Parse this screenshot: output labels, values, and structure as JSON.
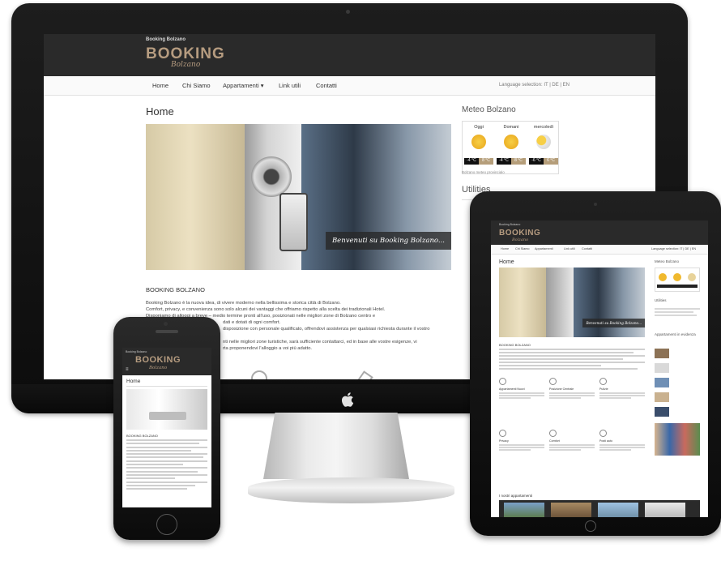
{
  "site": {
    "small_title": "Booking Bolzano",
    "brand": "BOOKING",
    "brand_sub": "Bolzano",
    "nav": [
      "Home",
      "Chi Siamo",
      "Appartamenti  ▾",
      "Link utili",
      "Contatti"
    ],
    "language": "Language selection: IT | DE | EN",
    "page_title": "Home",
    "hero_caption": "Benvenuti su Booking Bolzano...",
    "section_title": "BOOKING BOLZANO",
    "paragraphs": [
      "Booking Bolzano è la nuova idea, di vivere moderno nella bellissima e storica città di Bolzano.",
      "Comfort, privacy, e convenienza sono solo alcuni dei vantaggi che offriamo rispetto alla scelta dei tradizionali Hotel.",
      "Disponiamo di alloggi a breve – medio termine pronti all'uso, posizionati nelle migliori zone di Bolzano centro e",
      "dati e dotati di ogni comfort.",
      "disposizione con personale qualificato, offrendovi assistenza per qualsiasi richiesta durante il vostro",
      "",
      "nti nelle migliori zone turistiche, sarà sufficiente contattarci, ed in base alle vostre esigenze, vi",
      "rta proponendovi l'alloggio a voi più adatto."
    ],
    "meteo_title": "Meteo Bolzano",
    "meteo": [
      {
        "day": "Oggi",
        "lo": "-4 °C",
        "hi": "8 °C"
      },
      {
        "day": "Domani",
        "lo": "-4 °C",
        "hi": "8 °C"
      },
      {
        "day": "mercoledì",
        "lo": "-6 °C",
        "hi": "6 °C"
      }
    ],
    "meteo_credit": "Bolzano meteo provincialo",
    "utilities_title": "Utilities"
  },
  "ipad": {
    "nav": [
      "Home",
      "Chi Siamo",
      "Appartamenti",
      "Link utili",
      "Contatti"
    ],
    "features": [
      "Appartamenti Nuovi",
      "Posizione Centrale",
      "Pulizie",
      "Privacy",
      "Comfort",
      "Posti auto"
    ],
    "apartments_title": "I nostri appartamenti",
    "side_titles": [
      "Meteo Bolzano",
      "Utilities",
      "Appartamenti in evidenza"
    ]
  },
  "colors": {
    "header_dark": "#2a2a2a",
    "brand_gold": "#b69c80"
  }
}
